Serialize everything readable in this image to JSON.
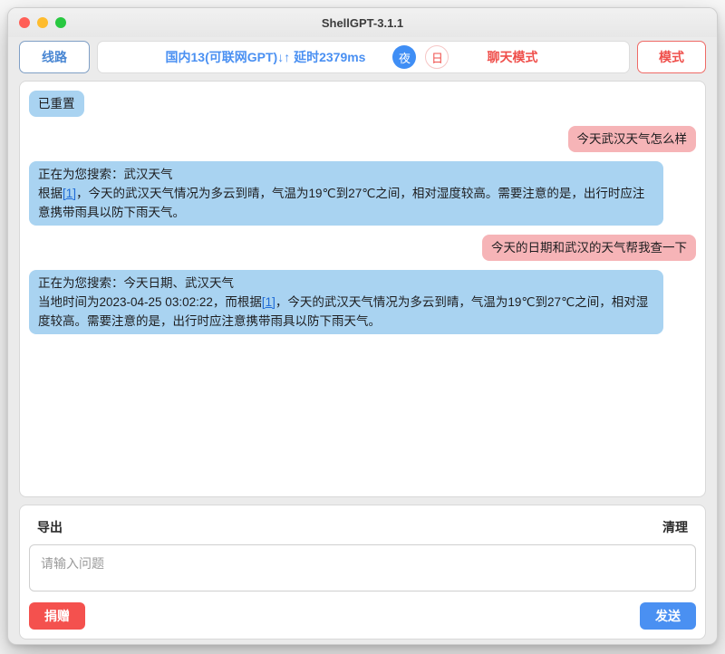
{
  "window": {
    "title": "ShellGPT-3.1.1"
  },
  "toolbar": {
    "line_button": "线路",
    "status": "国内13(可联网GPT)↓↑ 延时2379ms",
    "night_toggle": "夜",
    "day_toggle": "日",
    "chat_mode": "聊天模式",
    "mode_button": "模式"
  },
  "chat": {
    "messages": [
      {
        "type": "system",
        "text": "已重置"
      },
      {
        "type": "user",
        "text": "今天武汉天气怎么样"
      },
      {
        "type": "bot",
        "line1": "正在为您搜索：武汉天气",
        "pre": "根据",
        "link": "[1]",
        "post": "，今天的武汉天气情况为多云到晴，气温为19℃到27℃之间，相对湿度较高。需要注意的是，出行时应注意携带雨具以防下雨天气。"
      },
      {
        "type": "user",
        "text": "今天的日期和武汉的天气帮我查一下"
      },
      {
        "type": "bot",
        "line1": "正在为您搜索：今天日期、武汉天气",
        "pre": "当地时间为2023-04-25 03:02:22，而根据",
        "link": "[1]",
        "post": "，今天的武汉天气情况为多云到晴，气温为19℃到27℃之间，相对湿度较高。需要注意的是，出行时应注意携带雨具以防下雨天气。"
      }
    ]
  },
  "composer": {
    "export_label": "导出",
    "clear_label": "清理",
    "placeholder": "请输入问题",
    "donate_label": "捐赠",
    "send_label": "发送"
  },
  "colors": {
    "accent_blue": "#4a90f2",
    "accent_red": "#f4514e",
    "bubble_blue": "#a9d3f1",
    "bubble_pink": "#f6b4b7"
  }
}
